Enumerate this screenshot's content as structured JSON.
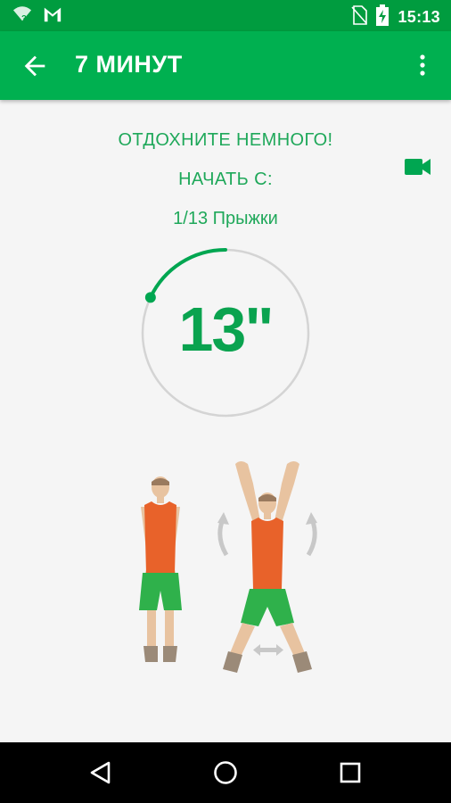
{
  "status_bar": {
    "time": "15:13",
    "icons": [
      "wifi-unknown-icon",
      "gmail-icon",
      "no-sim-icon",
      "battery-charging-icon"
    ]
  },
  "app_bar": {
    "title": "7 МИНУТ",
    "back_icon": "arrow-back-icon",
    "menu_icon": "more-vert-icon"
  },
  "rest": {
    "heading": "ОТДОХНИТЕ НЕМНОГО!",
    "start_label": "НАЧАТЬ С:",
    "next_exercise": "1/13 Прыжки",
    "video_icon": "videocam-icon"
  },
  "timer": {
    "value": "13\"",
    "seconds_remaining": 13,
    "progress_fraction": 0.18
  },
  "illustration": {
    "name": "jumping-jacks",
    "figures": [
      "standing-pose",
      "arms-up-jump-pose"
    ]
  },
  "colors": {
    "status_bar": "#009c3f",
    "app_bar": "#00b050",
    "accent_text": "#1fa85a",
    "timer_text": "#0aa34f",
    "shirt": "#e8622a",
    "shorts": "#2fb14b"
  },
  "nav_bar": {
    "buttons": [
      "back-triangle-icon",
      "home-circle-icon",
      "recents-square-icon"
    ]
  }
}
